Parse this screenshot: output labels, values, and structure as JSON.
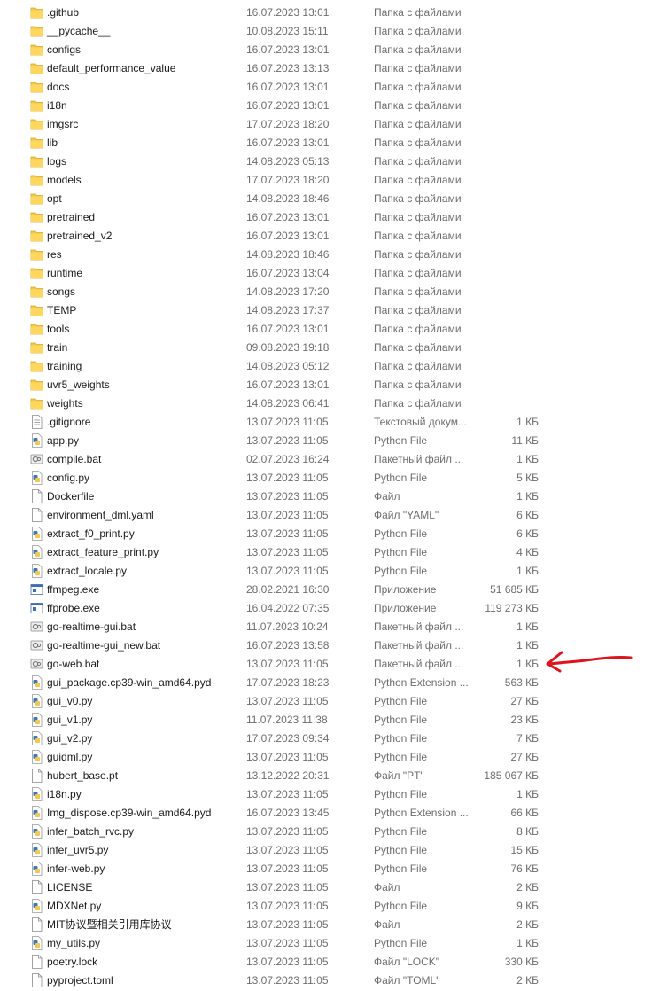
{
  "files": [
    {
      "name": ".github",
      "date": "16.07.2023 13:01",
      "type": "Папка с файлами",
      "size": "",
      "icon": "folder-icon"
    },
    {
      "name": "__pycache__",
      "date": "10.08.2023 15:11",
      "type": "Папка с файлами",
      "size": "",
      "icon": "folder-icon"
    },
    {
      "name": "configs",
      "date": "16.07.2023 13:01",
      "type": "Папка с файлами",
      "size": "",
      "icon": "folder-icon"
    },
    {
      "name": "default_performance_value",
      "date": "16.07.2023 13:13",
      "type": "Папка с файлами",
      "size": "",
      "icon": "folder-icon"
    },
    {
      "name": "docs",
      "date": "16.07.2023 13:01",
      "type": "Папка с файлами",
      "size": "",
      "icon": "folder-icon"
    },
    {
      "name": "i18n",
      "date": "16.07.2023 13:01",
      "type": "Папка с файлами",
      "size": "",
      "icon": "folder-icon"
    },
    {
      "name": "imgsrc",
      "date": "17.07.2023 18:20",
      "type": "Папка с файлами",
      "size": "",
      "icon": "folder-icon"
    },
    {
      "name": "lib",
      "date": "16.07.2023 13:01",
      "type": "Папка с файлами",
      "size": "",
      "icon": "folder-icon"
    },
    {
      "name": "logs",
      "date": "14.08.2023 05:13",
      "type": "Папка с файлами",
      "size": "",
      "icon": "folder-icon"
    },
    {
      "name": "models",
      "date": "17.07.2023 18:20",
      "type": "Папка с файлами",
      "size": "",
      "icon": "folder-icon"
    },
    {
      "name": "opt",
      "date": "14.08.2023 18:46",
      "type": "Папка с файлами",
      "size": "",
      "icon": "folder-icon"
    },
    {
      "name": "pretrained",
      "date": "16.07.2023 13:01",
      "type": "Папка с файлами",
      "size": "",
      "icon": "folder-icon"
    },
    {
      "name": "pretrained_v2",
      "date": "16.07.2023 13:01",
      "type": "Папка с файлами",
      "size": "",
      "icon": "folder-icon"
    },
    {
      "name": "res",
      "date": "14.08.2023 18:46",
      "type": "Папка с файлами",
      "size": "",
      "icon": "folder-icon"
    },
    {
      "name": "runtime",
      "date": "16.07.2023 13:04",
      "type": "Папка с файлами",
      "size": "",
      "icon": "folder-icon"
    },
    {
      "name": "songs",
      "date": "14.08.2023 17:20",
      "type": "Папка с файлами",
      "size": "",
      "icon": "folder-icon"
    },
    {
      "name": "TEMP",
      "date": "14.08.2023 17:37",
      "type": "Папка с файлами",
      "size": "",
      "icon": "folder-icon"
    },
    {
      "name": "tools",
      "date": "16.07.2023 13:01",
      "type": "Папка с файлами",
      "size": "",
      "icon": "folder-icon"
    },
    {
      "name": "train",
      "date": "09.08.2023 19:18",
      "type": "Папка с файлами",
      "size": "",
      "icon": "folder-icon"
    },
    {
      "name": "training",
      "date": "14.08.2023 05:12",
      "type": "Папка с файлами",
      "size": "",
      "icon": "folder-icon"
    },
    {
      "name": "uvr5_weights",
      "date": "16.07.2023 13:01",
      "type": "Папка с файлами",
      "size": "",
      "icon": "folder-icon"
    },
    {
      "name": "weights",
      "date": "14.08.2023 06:41",
      "type": "Папка с файлами",
      "size": "",
      "icon": "folder-icon"
    },
    {
      "name": ".gitignore",
      "date": "13.07.2023 11:05",
      "type": "Текстовый докум...",
      "size": "1 КБ",
      "icon": "text-file-icon"
    },
    {
      "name": "app.py",
      "date": "13.07.2023 11:05",
      "type": "Python File",
      "size": "11 КБ",
      "icon": "python-file-icon"
    },
    {
      "name": "compile.bat",
      "date": "02.07.2023 16:24",
      "type": "Пакетный файл ...",
      "size": "1 КБ",
      "icon": "batch-file-icon"
    },
    {
      "name": "config.py",
      "date": "13.07.2023 11:05",
      "type": "Python File",
      "size": "5 КБ",
      "icon": "python-file-icon"
    },
    {
      "name": "Dockerfile",
      "date": "13.07.2023 11:05",
      "type": "Файл",
      "size": "1 КБ",
      "icon": "blank-file-icon"
    },
    {
      "name": "environment_dml.yaml",
      "date": "13.07.2023 11:05",
      "type": "Файл \"YAML\"",
      "size": "6 КБ",
      "icon": "blank-file-icon"
    },
    {
      "name": "extract_f0_print.py",
      "date": "13.07.2023 11:05",
      "type": "Python File",
      "size": "6 КБ",
      "icon": "python-file-icon"
    },
    {
      "name": "extract_feature_print.py",
      "date": "13.07.2023 11:05",
      "type": "Python File",
      "size": "4 КБ",
      "icon": "python-file-icon"
    },
    {
      "name": "extract_locale.py",
      "date": "13.07.2023 11:05",
      "type": "Python File",
      "size": "1 КБ",
      "icon": "python-file-icon"
    },
    {
      "name": "ffmpeg.exe",
      "date": "28.02.2021 16:30",
      "type": "Приложение",
      "size": "51 685 КБ",
      "icon": "exe-file-icon"
    },
    {
      "name": "ffprobe.exe",
      "date": "16.04.2022 07:35",
      "type": "Приложение",
      "size": "119 273 КБ",
      "icon": "exe-file-icon"
    },
    {
      "name": "go-realtime-gui.bat",
      "date": "11.07.2023 10:24",
      "type": "Пакетный файл ...",
      "size": "1 КБ",
      "icon": "batch-file-icon"
    },
    {
      "name": "go-realtime-gui_new.bat",
      "date": "16.07.2023 13:58",
      "type": "Пакетный файл ...",
      "size": "1 КБ",
      "icon": "batch-file-icon"
    },
    {
      "name": "go-web.bat",
      "date": "13.07.2023 11:05",
      "type": "Пакетный файл ...",
      "size": "1 КБ",
      "icon": "batch-file-icon"
    },
    {
      "name": "gui_package.cp39-win_amd64.pyd",
      "date": "17.07.2023 18:23",
      "type": "Python Extension ...",
      "size": "563 КБ",
      "icon": "python-file-icon"
    },
    {
      "name": "gui_v0.py",
      "date": "13.07.2023 11:05",
      "type": "Python File",
      "size": "27 КБ",
      "icon": "python-file-icon"
    },
    {
      "name": "gui_v1.py",
      "date": "11.07.2023 11:38",
      "type": "Python File",
      "size": "23 КБ",
      "icon": "python-file-icon"
    },
    {
      "name": "gui_v2.py",
      "date": "17.07.2023 09:34",
      "type": "Python File",
      "size": "7 КБ",
      "icon": "python-file-icon"
    },
    {
      "name": "guidml.py",
      "date": "13.07.2023 11:05",
      "type": "Python File",
      "size": "27 КБ",
      "icon": "python-file-icon"
    },
    {
      "name": "hubert_base.pt",
      "date": "13.12.2022 20:31",
      "type": "Файл \"PT\"",
      "size": "185 067 КБ",
      "icon": "blank-file-icon"
    },
    {
      "name": "i18n.py",
      "date": "13.07.2023 11:05",
      "type": "Python File",
      "size": "1 КБ",
      "icon": "python-file-icon"
    },
    {
      "name": "Img_dispose.cp39-win_amd64.pyd",
      "date": "16.07.2023 13:45",
      "type": "Python Extension ...",
      "size": "66 КБ",
      "icon": "python-file-icon"
    },
    {
      "name": "infer_batch_rvc.py",
      "date": "13.07.2023 11:05",
      "type": "Python File",
      "size": "8 КБ",
      "icon": "python-file-icon"
    },
    {
      "name": "infer_uvr5.py",
      "date": "13.07.2023 11:05",
      "type": "Python File",
      "size": "15 КБ",
      "icon": "python-file-icon"
    },
    {
      "name": "infer-web.py",
      "date": "13.07.2023 11:05",
      "type": "Python File",
      "size": "76 КБ",
      "icon": "python-file-icon"
    },
    {
      "name": "LICENSE",
      "date": "13.07.2023 11:05",
      "type": "Файл",
      "size": "2 КБ",
      "icon": "blank-file-icon"
    },
    {
      "name": "MDXNet.py",
      "date": "13.07.2023 11:05",
      "type": "Python File",
      "size": "9 КБ",
      "icon": "python-file-icon"
    },
    {
      "name": "MIT协议暨相关引用库协议",
      "date": "13.07.2023 11:05",
      "type": "Файл",
      "size": "2 КБ",
      "icon": "blank-file-icon"
    },
    {
      "name": "my_utils.py",
      "date": "13.07.2023 11:05",
      "type": "Python File",
      "size": "1 КБ",
      "icon": "python-file-icon"
    },
    {
      "name": "poetry.lock",
      "date": "13.07.2023 11:05",
      "type": "Файл \"LOCK\"",
      "size": "330 КБ",
      "icon": "blank-file-icon"
    },
    {
      "name": "pyproject.toml",
      "date": "13.07.2023 11:05",
      "type": "Файл \"TOML\"",
      "size": "2 КБ",
      "icon": "blank-file-icon"
    }
  ],
  "annotation": {
    "color": "#e0141c",
    "icon": "red-arrow-icon"
  }
}
